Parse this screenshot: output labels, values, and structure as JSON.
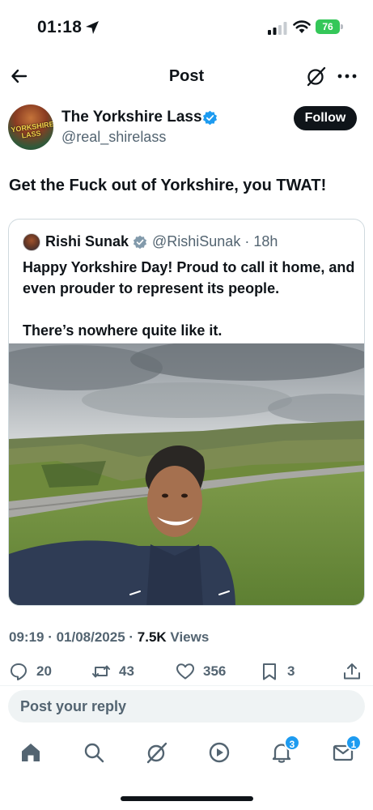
{
  "status_bar": {
    "time": "01:18",
    "battery_level": "76",
    "battery_color": "#34c759"
  },
  "nav": {
    "title": "Post"
  },
  "author": {
    "name": "The Yorkshire Lass",
    "handle": "@real_shirelass",
    "avatar_text": "YORKSHIRE LASS",
    "follow_label": "Follow"
  },
  "tweet": {
    "text": "Get the Fuck out of Yorkshire, you TWAT!"
  },
  "quoted": {
    "name": "Rishi Sunak",
    "handle_time": "@RishiSunak · 18h",
    "text": "Happy Yorkshire Day! Proud to call it home, and even prouder to represent its people.\n\nThere’s nowhere quite like it."
  },
  "meta": {
    "time_date": "09:19 · 01/08/2025 · ",
    "views_count": "7.5K",
    "views_label": " Views"
  },
  "actions": {
    "replies": "20",
    "reposts": "43",
    "likes": "356",
    "bookmarks": "3"
  },
  "reply_box": {
    "placeholder": "Post your reply"
  },
  "tab_bar": {
    "notifications_badge": "3",
    "messages_badge": "1"
  },
  "colors": {
    "accent": "#1d9bf0",
    "text": "#0f1419",
    "secondary": "#536471"
  }
}
